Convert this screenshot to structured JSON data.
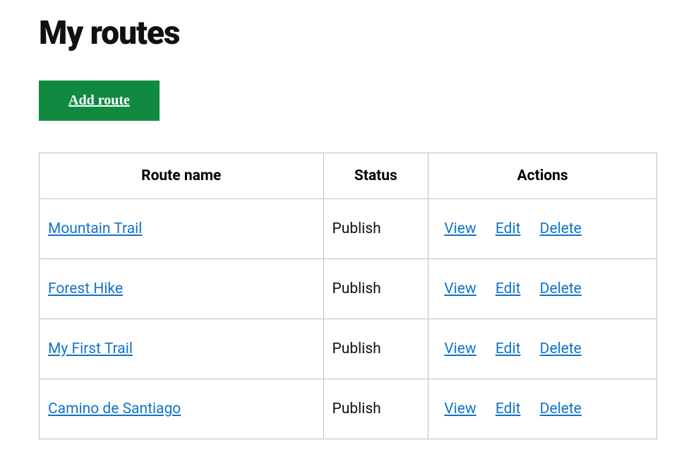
{
  "page": {
    "title": "My routes",
    "add_button_label": "Add route"
  },
  "table": {
    "headers": {
      "name": "Route name",
      "status": "Status",
      "actions": "Actions"
    },
    "action_labels": {
      "view": "View",
      "edit": "Edit",
      "delete": "Delete"
    },
    "rows": [
      {
        "name": "Mountain Trail",
        "status": "Publish"
      },
      {
        "name": "Forest Hike",
        "status": "Publish"
      },
      {
        "name": "My First Trail",
        "status": "Publish"
      },
      {
        "name": "Camino de Santiago",
        "status": "Publish"
      }
    ]
  }
}
